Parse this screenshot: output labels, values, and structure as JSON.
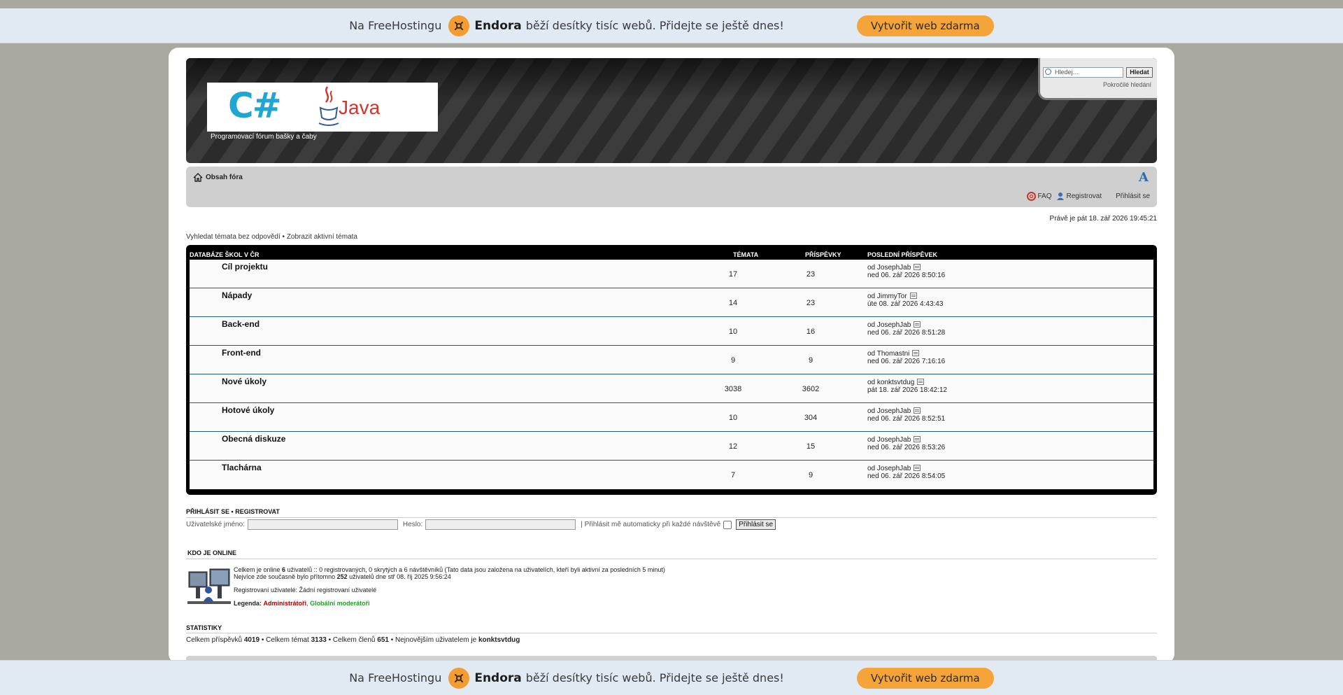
{
  "promo": {
    "prefix": "Na FreeHostingu",
    "brand": "Endora",
    "suffix": "běží desítky tisíc webů. Přidejte se ještě dnes!",
    "cta": "Vytvořit web zdarma",
    "logo_icon": "endora-logo-icon",
    "accent": "#f5a43a"
  },
  "header": {
    "logo_left": "C#",
    "logo_right": "Java",
    "site_description": "Programovací fórum bašky a čaby",
    "search_placeholder": "Hledej…",
    "search_button": "Hledat",
    "advanced_search": "Pokročilé hledání"
  },
  "navbar": {
    "home_label": "Obsah fóra",
    "faq": "FAQ",
    "register": "Registrovat",
    "login": "Přihlásit se"
  },
  "current_time": "Právě je pát 18. zář 2026 19:45:21",
  "quick_links": {
    "unanswered": "Vyhledat témata bez odpovědí",
    "sep": "•",
    "active": "Zobrazit aktivní témata"
  },
  "forum": {
    "category": "DATABÁZE ŠKOL V ČR",
    "col_topics": "TÉMATA",
    "col_posts": "PŘÍSPĚVKY",
    "col_last": "POSLEDNÍ PŘÍSPĚVEK",
    "rows": [
      {
        "title": "Cíl projektu",
        "topics": "17",
        "posts": "23",
        "by": "od JosephJab",
        "date": "ned 06. zář 2026 8:50:16"
      },
      {
        "title": "Nápady",
        "topics": "14",
        "posts": "23",
        "by": "od JimmyTor",
        "date": "úte 08. zář 2026 4:43:43"
      },
      {
        "title": "Back-end",
        "topics": "10",
        "posts": "16",
        "by": "od JosephJab",
        "date": "ned 06. zář 2026 8:51:28"
      },
      {
        "title": "Front-end",
        "topics": "9",
        "posts": "9",
        "by": "od Thomastni",
        "date": "ned 06. zář 2026 7:16:16"
      },
      {
        "title": "Nové úkoly",
        "topics": "3038",
        "posts": "3602",
        "by": "od konktsvtdug",
        "date": "pát 18. zář 2026 18:42:12"
      },
      {
        "title": "Hotové úkoly",
        "topics": "10",
        "posts": "304",
        "by": "od JosephJab",
        "date": "ned 06. zář 2026 8:52:51"
      },
      {
        "title": "Obecná diskuze",
        "topics": "12",
        "posts": "15",
        "by": "od JosephJab",
        "date": "ned 06. zář 2026 8:53:26"
      },
      {
        "title": "Tlachárna",
        "topics": "7",
        "posts": "9",
        "by": "od JosephJab",
        "date": "ned 06. zář 2026 8:54:05"
      }
    ]
  },
  "login": {
    "heading_login": "PŘIHLÁSIT SE",
    "heading_sep": "•",
    "heading_register": "REGISTROVAT",
    "username_label": "Uživatelské jméno:",
    "password_label": "Heslo:",
    "remember_label": "| Přihlásit mě automaticky při každé návštěvě",
    "submit": "Přihlásit se"
  },
  "online": {
    "heading": "KDO JE ONLINE",
    "line1_a": "Celkem je online ",
    "line1_count": "6",
    "line1_b": " uživatelů :: 0 registrovaných, 0 skrytých a 6 návštěvníků (Tato data jsou založena na uživatelích, kteří byli aktivní za posledních 5 minut)",
    "line2_a": "Nejvíce zde současně bylo přítomno ",
    "line2_count": "252",
    "line2_b": " uživatelů dne stř 08. říj 2025 9:56:24",
    "registered": "Registrovaní uživatelé: Žádní registrovaní uživatelé",
    "legend_label": "Legenda:",
    "legend_admins": "Administrátoři",
    "legend_sep": ", ",
    "legend_mods": "Globální moderátoři"
  },
  "stats": {
    "heading": "STATISTIKY",
    "a": "Celkem příspěvků ",
    "posts": "4019",
    "b": " • Celkem témat ",
    "topics": "3133",
    "c": " • Celkem členů ",
    "members": "651",
    "d": " • Nejnovějším uživatelem je ",
    "newest": "konktsvtdug"
  }
}
